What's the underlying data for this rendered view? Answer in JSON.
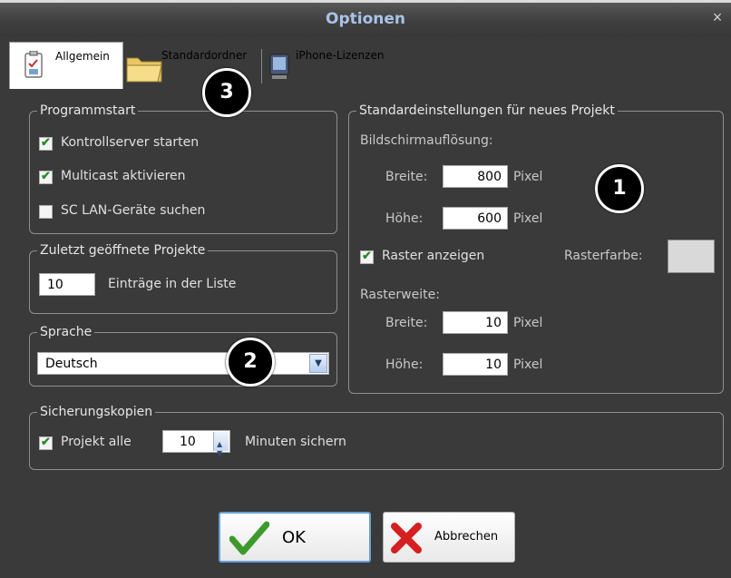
{
  "window": {
    "title": "Optionen",
    "close_glyph": "×"
  },
  "tabs": [
    {
      "label": "Allgemein",
      "icon": "checklist-icon",
      "active": true
    },
    {
      "label": "Standardordner",
      "icon": "folder-icon",
      "active": false
    },
    {
      "label": "iPhone-Lizenzen",
      "icon": "device-icon",
      "active": false
    }
  ],
  "program_start": {
    "title": "Programmstart",
    "items": [
      {
        "label": "Kontrollserver starten",
        "checked": true
      },
      {
        "label": "Multicast aktivieren",
        "checked": true
      },
      {
        "label": "SC LAN-Geräte suchen",
        "checked": false
      }
    ]
  },
  "recent": {
    "title": "Zuletzt geöffnete Projekte",
    "value": "10",
    "suffix": "Einträge in der Liste"
  },
  "language": {
    "title": "Sprache",
    "selected": "Deutsch"
  },
  "defaults": {
    "title": "Standardeinstellungen für neues Projekt",
    "resolution_label": "Bildschirmauflösung:",
    "width_label": "Breite:",
    "width_value": "800",
    "height_label": "Höhe:",
    "height_value": "600",
    "unit": "Pixel",
    "grid_show_label": "Raster anzeigen",
    "grid_show_checked": true,
    "grid_color_label": "Rasterfarbe:",
    "grid_color": "#d9d9d9",
    "grid_width_label": "Rasterweite:",
    "grid_w_label": "Breite:",
    "grid_w_value": "10",
    "grid_h_label": "Höhe:",
    "grid_h_value": "10"
  },
  "backup": {
    "title": "Sicherungskopien",
    "checkbox_label": "Projekt alle",
    "checked": true,
    "value": "10",
    "suffix": "Minuten sichern"
  },
  "badges": [
    "1",
    "2",
    "3"
  ],
  "buttons": {
    "ok": "OK",
    "cancel": "Abbrechen"
  },
  "colors": {
    "background": "#3a3a3a",
    "title_text": "#a9c3e8",
    "check": "#2a8a2a",
    "ok_border": "#6aa0d8",
    "cancel_x": "#d42020"
  }
}
